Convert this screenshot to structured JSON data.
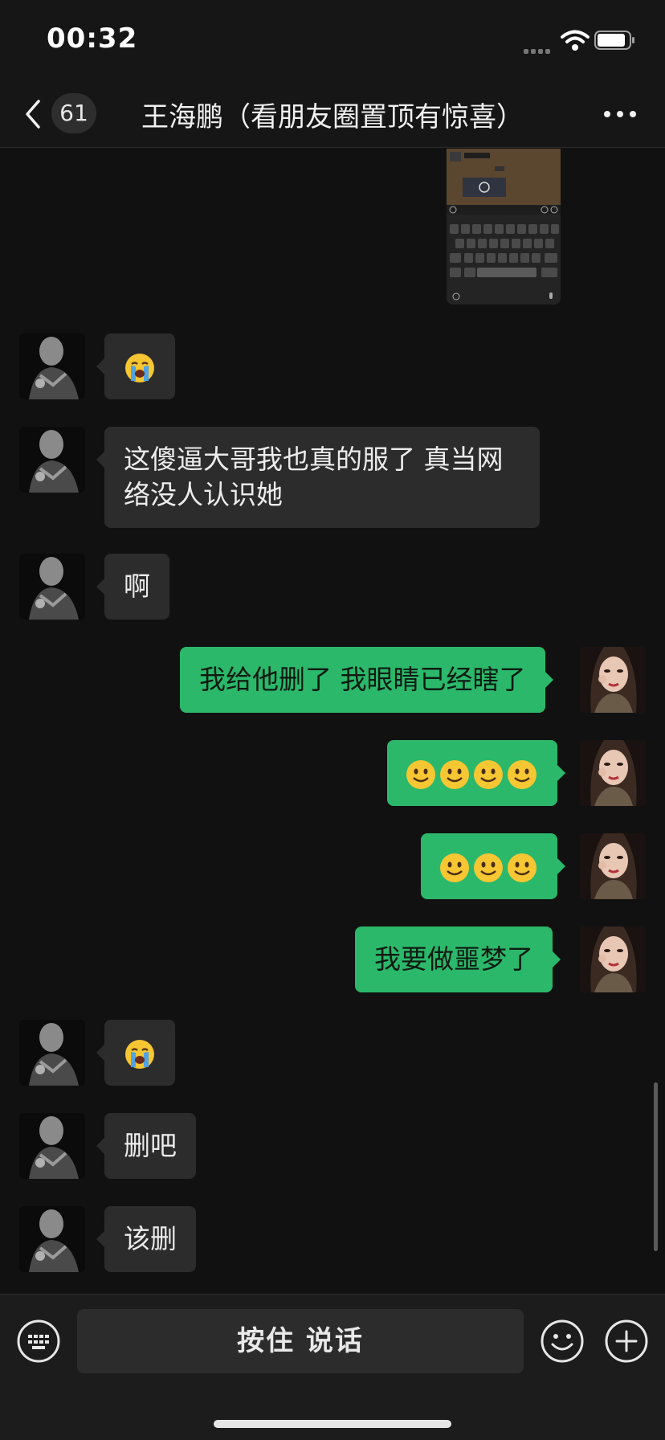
{
  "status_bar": {
    "time": "00:32"
  },
  "nav": {
    "unread_count": "61",
    "title": "王海鹏（看朋友圈置顶有惊喜）"
  },
  "messages": [
    {
      "side": "left",
      "type": "emoji",
      "emoji": "loudly-crying-face",
      "text": "😭"
    },
    {
      "side": "left",
      "type": "text",
      "text": "这傻逼大哥我也真的服了 真当网络没人认识她"
    },
    {
      "side": "left",
      "type": "text",
      "text": "啊"
    },
    {
      "side": "right",
      "type": "text",
      "text": "我给他删了 我眼睛已经瞎了"
    },
    {
      "side": "right",
      "type": "emoji",
      "emoji": "smiling-face",
      "count": 4
    },
    {
      "side": "right",
      "type": "emoji",
      "emoji": "smiling-face",
      "count": 3
    },
    {
      "side": "right",
      "type": "text",
      "text": "我要做噩梦了"
    },
    {
      "side": "left",
      "type": "emoji",
      "emoji": "loudly-crying-face",
      "text": "😭"
    },
    {
      "side": "left",
      "type": "text",
      "text": "删吧"
    },
    {
      "side": "left",
      "type": "text",
      "text": "该删"
    }
  ],
  "input_bar": {
    "voice_label": "按住 说话"
  },
  "colors": {
    "background": "#111111",
    "bubble_incoming": "#2c2c2c",
    "bubble_outgoing": "#2bb86a",
    "header": "#161616"
  },
  "icons": [
    "back-chevron-icon",
    "more-dots-icon",
    "keyboard-icon",
    "emoji-face-icon",
    "plus-circle-icon"
  ]
}
